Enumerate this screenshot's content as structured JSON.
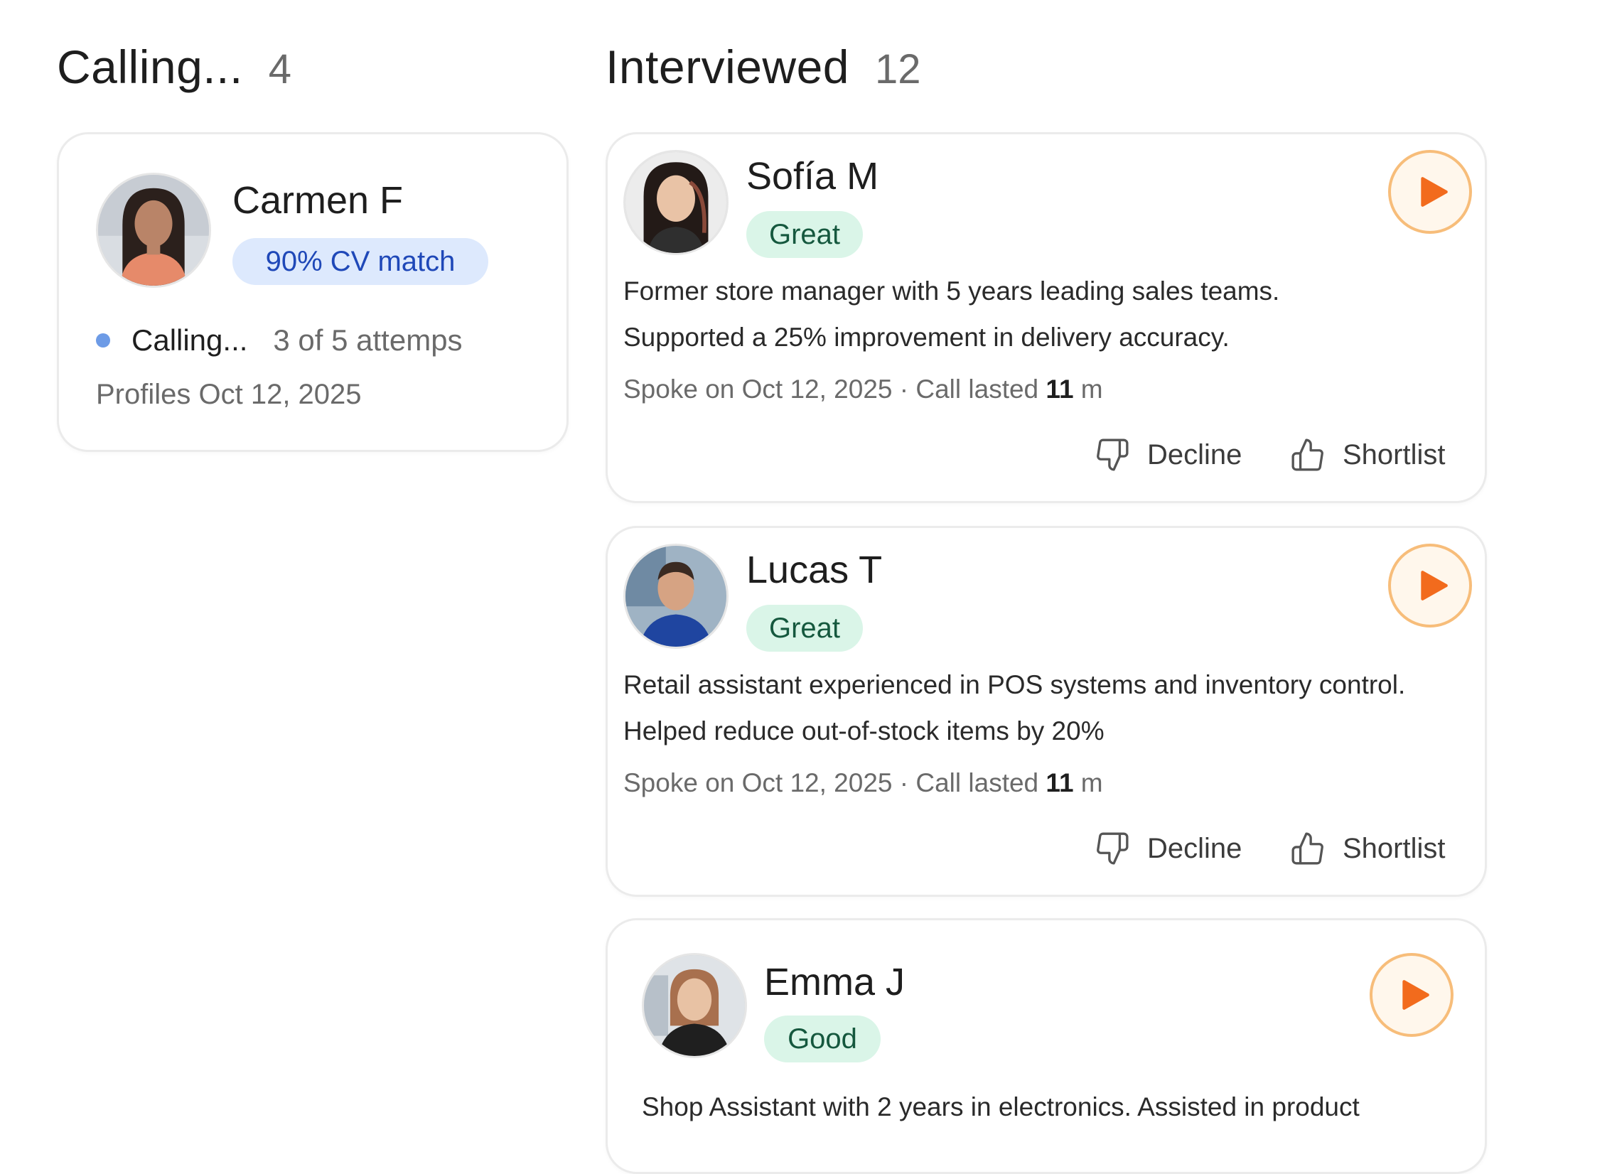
{
  "columns": {
    "calling": {
      "title": "Calling...",
      "count": "4",
      "card": {
        "name": "Carmen F",
        "match": "90% CV match",
        "status": "Calling...",
        "attempts": "3 of 5 attemps",
        "profiles_date": "Profiles Oct 12, 2025",
        "avatar": "avatar-woman-dark-hair"
      }
    },
    "interviewed": {
      "title": "Interviewed",
      "count": "12",
      "cards": [
        {
          "name": "Sofía M",
          "rating": "Great",
          "summary": [
            "Former store manager with 5 years leading sales teams.",
            "Supported a 25% improvement in delivery accuracy."
          ],
          "meta_prefix": "Spoke on Oct 12, 2025 · Call lasted ",
          "meta_duration": "11",
          "meta_unit": " m",
          "decline_label": "Decline",
          "shortlist_label": "Shortlist",
          "avatar": "avatar-woman-asian"
        },
        {
          "name": "Lucas T",
          "rating": "Great",
          "summary": [
            "Retail assistant experienced in POS systems and inventory control.",
            "Helped reduce out-of-stock items by 20%"
          ],
          "meta_prefix": "Spoke on Oct 12, 2025 · Call lasted ",
          "meta_duration": "11",
          "meta_unit": " m",
          "decline_label": "Decline",
          "shortlist_label": "Shortlist",
          "avatar": "avatar-man-blue-polo"
        },
        {
          "name": "Emma J",
          "rating": "Good",
          "summary": [
            "Shop Assistant with 2 years in electronics. Assisted in product"
          ],
          "avatar": "avatar-woman-blonde"
        }
      ]
    }
  },
  "icons": {
    "play": "play-icon",
    "decline": "thumbs-down-icon",
    "shortlist": "thumbs-up-icon"
  },
  "colors": {
    "accent_orange": "#f26b1d",
    "match_pill_bg": "#dde9fd",
    "match_pill_text": "#1f48b8",
    "rating_pill_bg": "#daf5e8",
    "rating_pill_text": "#15583e",
    "status_dot": "#6d9be6"
  }
}
